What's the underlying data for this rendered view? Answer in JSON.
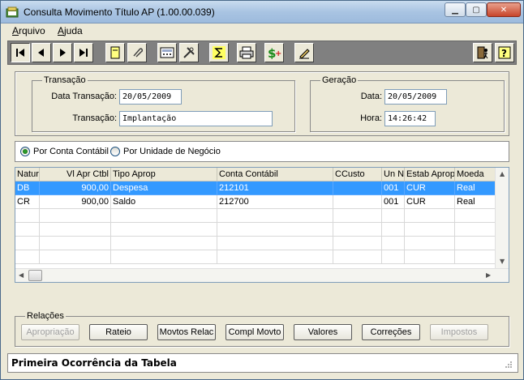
{
  "window": {
    "title": "Consulta Movimento Título AP (1.00.00.039)"
  },
  "menu": {
    "items": [
      {
        "label": "Arquivo",
        "key": "A",
        "rest": "rquivo"
      },
      {
        "label": "Ajuda",
        "key": "A",
        "rest": "juda"
      }
    ]
  },
  "toolbar": {
    "buttons": [
      "first-icon",
      "previous-icon",
      "next-icon",
      "last-icon",
      "new-document-icon",
      "attach-icon",
      "calculator-icon",
      "tools-icon",
      "sum-icon",
      "print-icon",
      "currency-icon",
      "edit-icon",
      "exit-icon",
      "help-icon"
    ]
  },
  "transacao": {
    "group_label": "Transação",
    "date_label": "Data Transação:",
    "date_value": "20/05/2009",
    "type_label": "Transação:",
    "type_value": "Implantação"
  },
  "geracao": {
    "group_label": "Geração",
    "date_label": "Data:",
    "date_value": "20/05/2009",
    "time_label": "Hora:",
    "time_value": "14:26:42"
  },
  "view": {
    "options": [
      "Por Conta Contábil",
      "Por Unidade de Negócio"
    ],
    "selected": "Por Conta Contábil"
  },
  "table": {
    "columns": [
      "Natur",
      "Vl Apr Ctbl",
      "Tipo Aprop",
      "Conta Contábil",
      "CCusto",
      "Un N",
      "Estab Aprop",
      "Moeda"
    ],
    "rows": [
      {
        "natur": "DB",
        "valor": "900,00",
        "tipo": "Despesa",
        "conta": "212101",
        "ccusto": "",
        "un": "001",
        "estab": "CUR",
        "moeda": "Real"
      },
      {
        "natur": "CR",
        "valor": "900,00",
        "tipo": "Saldo",
        "conta": "212700",
        "ccusto": "",
        "un": "001",
        "estab": "CUR",
        "moeda": "Real"
      }
    ],
    "selected_row": 0
  },
  "relacoes": {
    "group_label": "Relações",
    "buttons": [
      {
        "label": "Apropriação",
        "enabled": false
      },
      {
        "label": "Rateio",
        "enabled": true
      },
      {
        "label": "Movtos Relac",
        "enabled": true
      },
      {
        "label": "Compl Movto",
        "enabled": true
      },
      {
        "label": "Valores",
        "enabled": true
      },
      {
        "label": "Correções",
        "enabled": true
      },
      {
        "label": "Impostos",
        "enabled": false
      }
    ]
  },
  "status": {
    "text": "Primeira Ocorrência da Tabela"
  }
}
